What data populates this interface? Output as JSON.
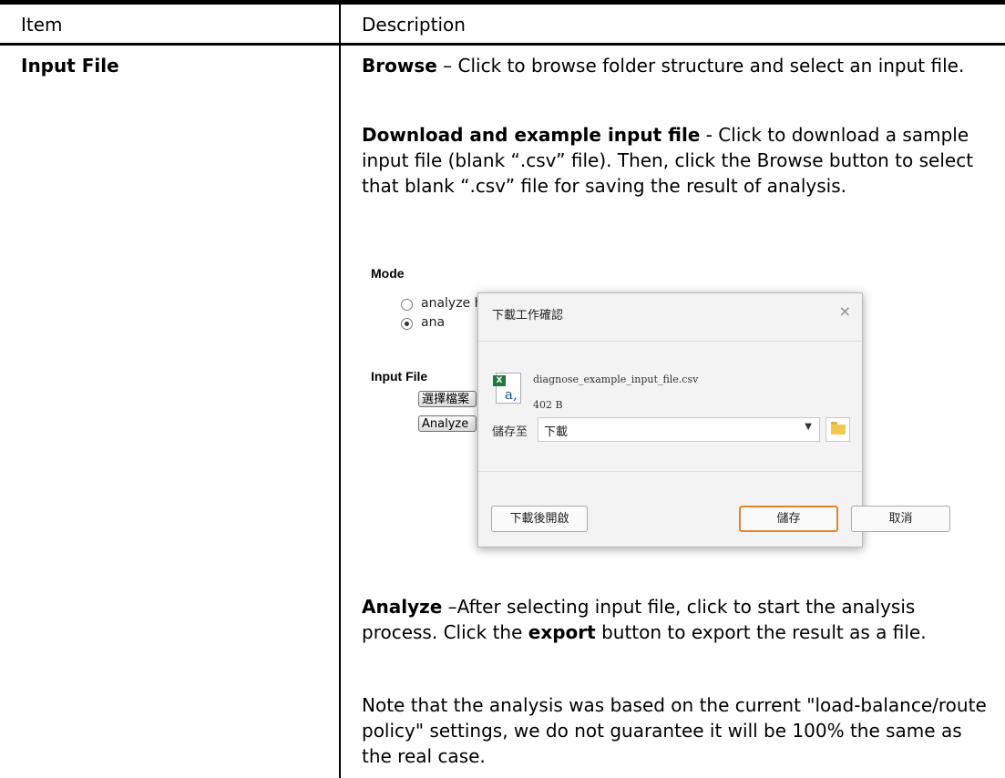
{
  "table": {
    "header_item": "Item",
    "header_description": "Description",
    "row_item": "Input File"
  },
  "description": {
    "browse_bold": "Browse",
    "browse_text": " – Click to browse folder structure and select an input file.",
    "download_bold": "Download and example input file",
    "download_text": " - Click to download a sample input file (blank “.csv” file). Then, click the Browse button to select that blank “.csv” file for saving the result of analysis.",
    "analyze_bold": "Analyze",
    "analyze_text1": " –After selecting input file, click to start the analysis process. Click the ",
    "export_bold": "export",
    "analyze_text2": " button to export the result as a file.",
    "note": "Note that the analysis was based on the current \"load-balance/route policy\" settings, we do not guarantee it will be 100% the same as the real case."
  },
  "screenshot": {
    "mode_label": "Mode",
    "mode_option1": "analyze how a packet will be sent",
    "mode_option2_partial": "ana",
    "input_file_label": "Input File",
    "choose_file_partial": "選擇檔案",
    "analyze_partial": "Analyze",
    "dialog": {
      "title": "下載工作確認",
      "close": "×",
      "file_name": "diagnose_example_input_file.csv",
      "file_size": "402 B",
      "save_to_label": "儲存至",
      "save_to_value": "下載",
      "open_after_button": "下載後開啟",
      "save_button": "儲存",
      "cancel_button": "取消"
    }
  }
}
